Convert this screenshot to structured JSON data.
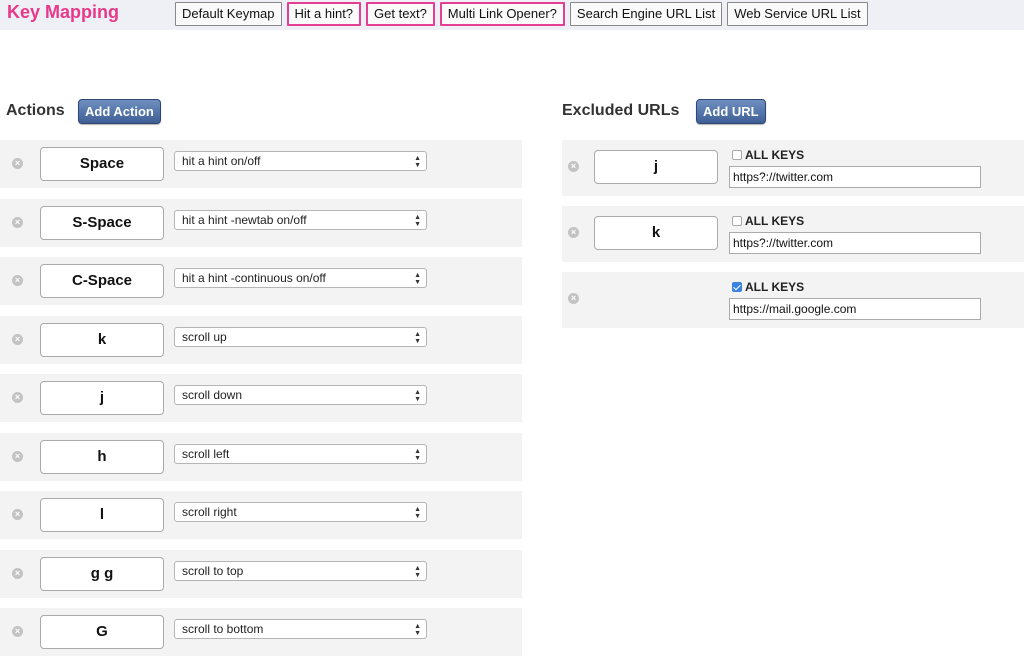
{
  "header": {
    "title": "Key Mapping",
    "tabs": [
      {
        "label": "Default Keymap",
        "highlighted": false
      },
      {
        "label": "Hit a hint?",
        "highlighted": true
      },
      {
        "label": "Get text?",
        "highlighted": true
      },
      {
        "label": "Multi Link Opener?",
        "highlighted": true
      },
      {
        "label": "Search Engine URL List",
        "highlighted": false
      },
      {
        "label": "Web Service URL List",
        "highlighted": false
      }
    ]
  },
  "actions": {
    "title": "Actions",
    "add_label": "Add Action",
    "items": [
      {
        "key": "Space",
        "action": "hit a hint on/off"
      },
      {
        "key": "S-Space",
        "action": "hit a hint -newtab on/off"
      },
      {
        "key": "C-Space",
        "action": "hit a hint -continuous on/off"
      },
      {
        "key": "k",
        "action": "scroll up"
      },
      {
        "key": "j",
        "action": "scroll down"
      },
      {
        "key": "h",
        "action": "scroll left"
      },
      {
        "key": "l",
        "action": "scroll right"
      },
      {
        "key": "g g",
        "action": "scroll to top"
      },
      {
        "key": "G",
        "action": "scroll to bottom"
      }
    ]
  },
  "excluded": {
    "title": "Excluded URLs",
    "add_label": "Add URL",
    "all_keys_label": "ALL KEYS",
    "items": [
      {
        "key": "j",
        "all_keys": false,
        "url": "https?://twitter.com"
      },
      {
        "key": "k",
        "all_keys": false,
        "url": "https?://twitter.com"
      },
      {
        "key": "",
        "all_keys": true,
        "url": "https://mail.google.com"
      }
    ]
  },
  "icons": {
    "remove": "remove-circle-icon",
    "select_arrow": "up-down-arrow-icon"
  },
  "colors": {
    "title": "#e8388a",
    "highlight_border": "#e43f93",
    "add_button": "#4a6ba3",
    "checkbox": "#3b82e0"
  }
}
